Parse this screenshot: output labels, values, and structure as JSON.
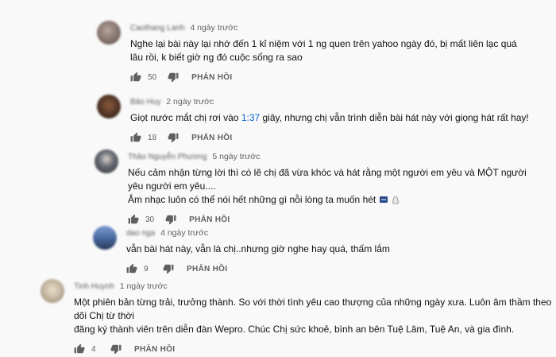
{
  "reply_label": "PHẢN HỒI",
  "comments": [
    {
      "author": "Caothang Lanh",
      "time": "4 ngày trước",
      "avatar_color": "#8c7b73",
      "lines": [
        "Nghe lại bài này lại nhớ đến 1 kỉ niệm với 1 ng quen trên yahoo ngày đó, bị mất liên lạc quá",
        "lâu rồi, k biết giờ ng đó cuộc sống ra sao"
      ],
      "likes": "50"
    },
    {
      "author": "Bảo Huy",
      "time": "2 ngày trước",
      "avatar_color": "#5a3a2a",
      "text_before": "Giọt nước mắt chị rơi vào ",
      "timestamp": "1:37",
      "text_after": " giây, nhưng chị vẫn trình diễn bài hát này với giọng hát rất hay!",
      "likes": "18"
    },
    {
      "author": "Thảo Nguyễn Phương",
      "time": "5 ngày trước",
      "avatar_color": "#6a6d75",
      "lines": [
        "Nếu cảm nhận từng lời thì có lẽ chị đã vừa khóc và hát rằng một người em yêu và MỘT người",
        "yêu người em yêu....",
        "Âm nhạc luôn có thể nói hết những gì nỗi lòng ta muốn hét"
      ],
      "likes": "30"
    },
    {
      "author": "dao nga",
      "time": "4 ngày trước",
      "avatar_color": "#4a6aa0",
      "lines": [
        "vẫn bài hát này, vẫn là chị..nhưng giờ nghe hay quá, thấm lắm"
      ],
      "likes": "9"
    },
    {
      "author": "Tinh Huynh",
      "time": "1 ngày trước",
      "avatar_color": "#c9bba6",
      "lines": [
        "Một phiên bản từng trải, trưởng thành. So với thời tình yêu cao thượng của những ngày xưa. Luôn âm thầm theo dõi Chị từ thời",
        "đăng ký thành viên trên diễn đàn Wepro. Chúc Chị sức khoẻ, bình an bên Tuệ Lâm, Tuệ An, và gia đình."
      ],
      "likes": "4"
    }
  ]
}
